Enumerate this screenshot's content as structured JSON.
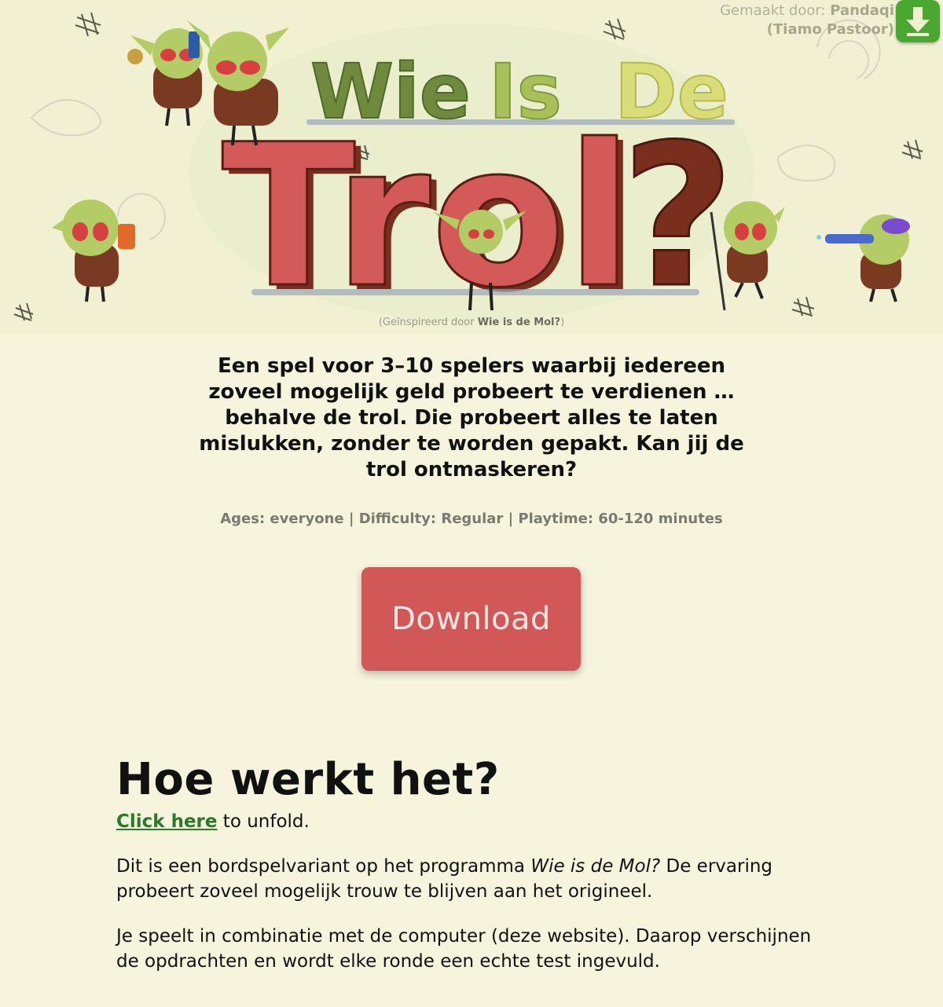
{
  "header": {
    "credit_label": "Gemaakt door:",
    "credit_name": "Pandaqi",
    "credit_person": "(Tiamo Pastoor)",
    "logo_line1_words": [
      "Wie",
      "Is",
      "De"
    ],
    "logo_line2": "Trol?",
    "inspired_prefix": "(Geïnspireerd door ",
    "inspired_name": "Wie is de Mol?",
    "inspired_suffix": ")",
    "corner_icon": "download-arrow-icon"
  },
  "intro": {
    "text": "Een spel voor 3–10 spelers waarbij iedereen zoveel mogelijk geld probeert te verdienen … behalve de trol. Die probeert alles te laten mislukken, zonder te worden gepakt. Kan jij de trol ontmaskeren?"
  },
  "meta": {
    "text": "Ages: everyone | Difficulty: Regular | Playtime: 60-120 minutes"
  },
  "download": {
    "label": "Download"
  },
  "how": {
    "title": "Hoe werkt het?",
    "unfold_link": "Click here",
    "unfold_rest": " to unfold.",
    "p1_before": "Dit is een bordspelvariant op het programma ",
    "p1_italic": "Wie is de Mol?",
    "p1_after": " De ervaring probeert zoveel mogelijk trouw te blijven aan het origineel.",
    "p2": "Je speelt in combinatie met de computer (deze website). Daarop verschijnen de opdrachten en wordt elke ronde een echte test ingevuld."
  },
  "colors": {
    "background": "#f6f4dc",
    "brand_red": "#d25757",
    "logo_green_dark": "#6a8a3a",
    "logo_green_light": "#a9c05a",
    "logo_yellow": "#d8dd78",
    "link_green": "#2a7a2a",
    "corner_button": "#4aa72f"
  }
}
